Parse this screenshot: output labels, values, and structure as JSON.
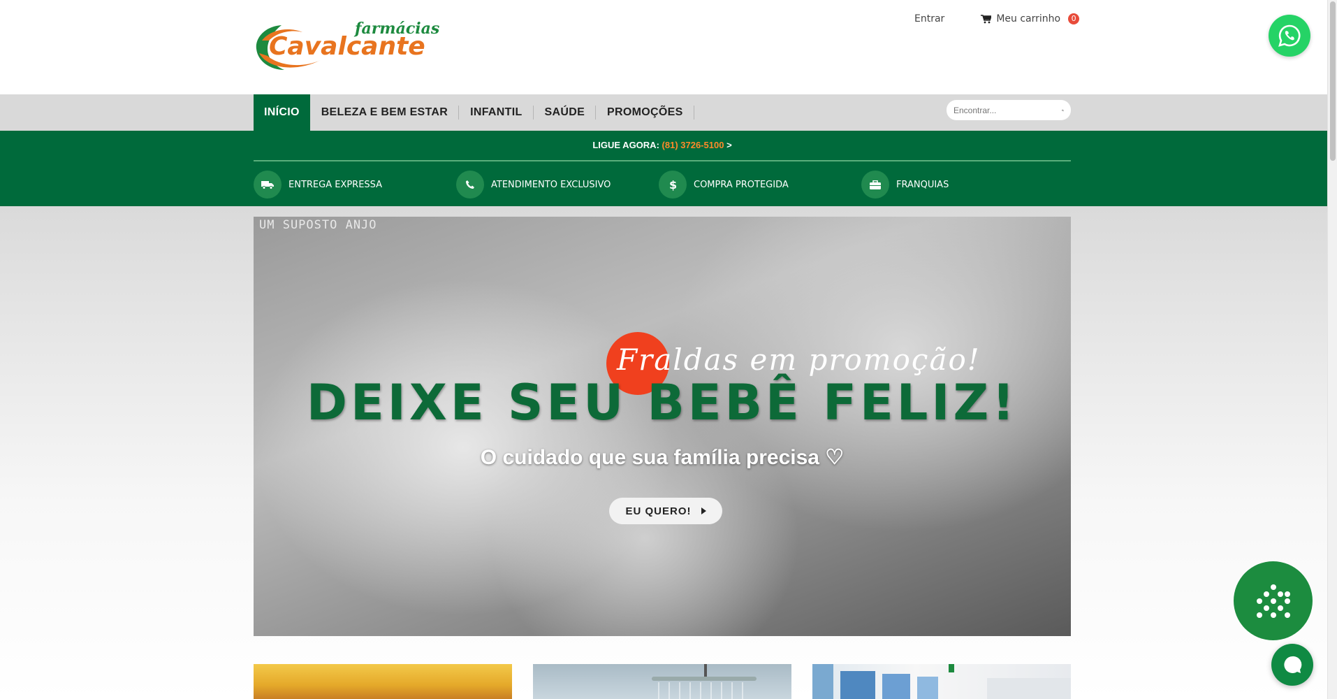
{
  "header": {
    "logo": {
      "top_text": "farmácias",
      "brand": "Cavalcante"
    },
    "login_label": "Entrar",
    "cart_label": "Meu carrinho",
    "cart_count": "0"
  },
  "nav": {
    "items": [
      {
        "label": "INÍCIO",
        "active": true
      },
      {
        "label": "BELEZA E BEM ESTAR",
        "active": false
      },
      {
        "label": "INFANTIL",
        "active": false
      },
      {
        "label": "SAÚDE",
        "active": false
      },
      {
        "label": "PROMOÇÕES",
        "active": false
      }
    ],
    "search_placeholder": "Encontrar..."
  },
  "banner": {
    "call_label": "LIGUE AGORA:",
    "phone": "(81) 3726-5100",
    "arrow": ">",
    "features": [
      {
        "label": "ENTREGA EXPRESSA",
        "icon": "truck-icon"
      },
      {
        "label": "ATENDIMENTO EXCLUSIVO",
        "icon": "phone-icon"
      },
      {
        "label": "COMPRA PROTEGIDA",
        "icon": "dollar-icon"
      },
      {
        "label": "FRANQUIAS",
        "icon": "briefcase-icon"
      }
    ]
  },
  "hero": {
    "watermark": "UM SUPOSTO ANJO",
    "script_text": "Fraldas em promoção!",
    "headline": "DEIXE SEU BEBÊ FELIZ!",
    "subheadline": "O cuidado que sua família precisa ♡",
    "cta_label": "EU QUERO!"
  },
  "colors": {
    "brand_green": "#006a3b",
    "accent_orange": "#ff8a2a",
    "accent_red": "#f0401e",
    "whatsapp": "#25d366"
  }
}
